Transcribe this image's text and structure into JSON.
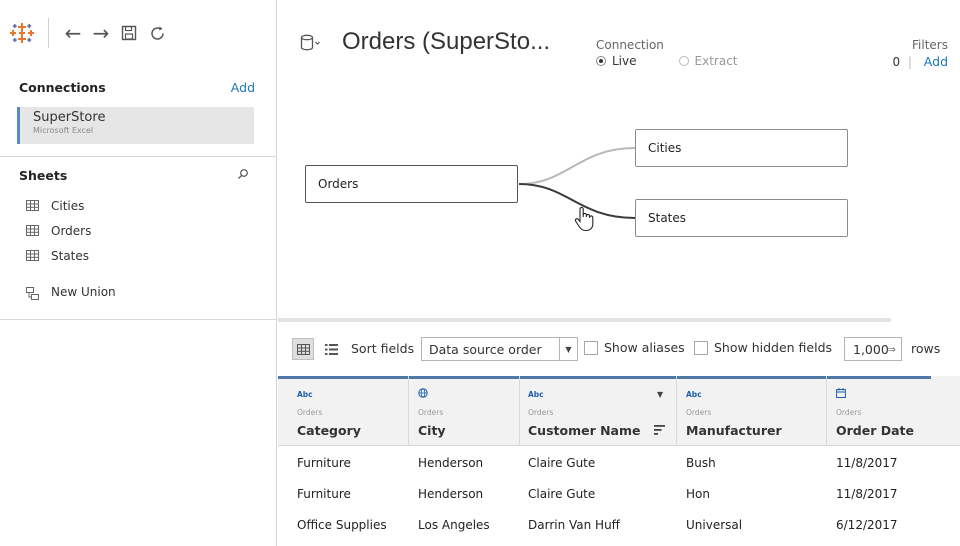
{
  "toolbar": {
    "icons": [
      "tableau-logo-icon",
      "back-arrow-icon",
      "forward-arrow-icon",
      "save-icon",
      "refresh-icon"
    ],
    "back": "←",
    "forward": "→"
  },
  "connections": {
    "title": "Connections",
    "add": "Add",
    "items": [
      {
        "name": "SuperStore",
        "type": "Microsoft Excel"
      }
    ]
  },
  "sheets": {
    "title": "Sheets",
    "items": [
      "Cities",
      "Orders",
      "States"
    ],
    "new_union": "New Union"
  },
  "datasource": {
    "title": "Orders (SuperSto...",
    "connection_label": "Connection",
    "live": "Live",
    "extract": "Extract",
    "selected": "Live",
    "filters_label": "Filters",
    "filters_count": "0",
    "filters_add": "Add"
  },
  "canvas": {
    "tables": [
      "Orders",
      "Cities",
      "States"
    ]
  },
  "grid_toolbar": {
    "sort_label": "Sort fields",
    "sort_value": "Data source order",
    "show_aliases": "Show aliases",
    "show_hidden": "Show hidden fields",
    "rows_value": "1,000",
    "rows_label": "rows"
  },
  "grid": {
    "columns": [
      {
        "type": "Abc",
        "source": "Orders",
        "name": "Category"
      },
      {
        "type": "globe-icon",
        "source": "Orders",
        "name": "City"
      },
      {
        "type": "Abc",
        "source": "Orders",
        "name": "Customer Name"
      },
      {
        "type": "Abc",
        "source": "Orders",
        "name": "Manufacturer"
      },
      {
        "type": "calendar-icon",
        "source": "Orders",
        "name": "Order Date"
      }
    ],
    "rows": [
      [
        "Furniture",
        "Henderson",
        "Claire Gute",
        "Bush",
        "11/8/2017"
      ],
      [
        "Furniture",
        "Henderson",
        "Claire Gute",
        "Hon",
        "11/8/2017"
      ],
      [
        "Office Supplies",
        "Los Angeles",
        "Darrin Van Huff",
        "Universal",
        "6/12/2017"
      ]
    ]
  },
  "colors": {
    "accent": "#1f77b4",
    "column_top": "#4e79a7",
    "logo": "#e8762d"
  }
}
